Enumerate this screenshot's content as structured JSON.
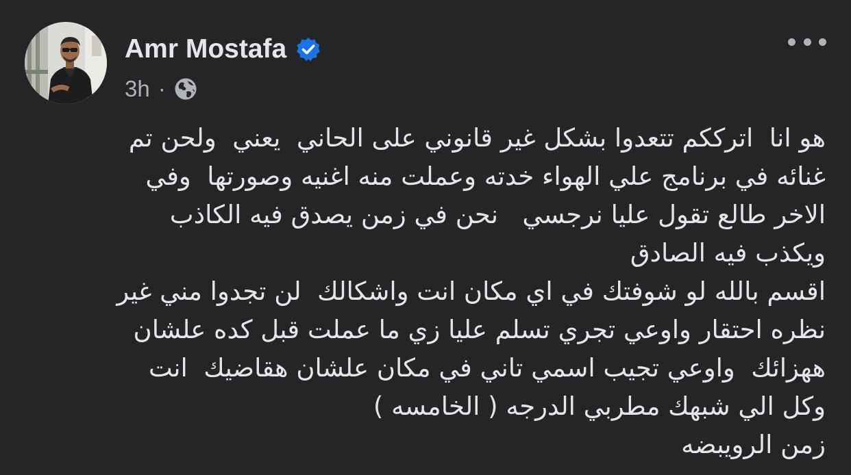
{
  "author": {
    "name": "Amr Mostafa",
    "verified": true,
    "time": "3h",
    "separator": "·",
    "audience_icon": "globe-icon"
  },
  "menu_icon": "more-options-icon",
  "colors": {
    "background": "#242526",
    "text_primary": "#e4e6eb",
    "text_secondary": "#b0b3b8",
    "verified_badge": "#1b74e4"
  },
  "post": {
    "lines": [
      "هو انا  اترككم تتعدوا بشكل غير قانوني على الحاني  يعني  ولحن تم",
      "غنائه في برنامج علي الهواء خدته وعملت منه اغنيه وصورتها  وفي",
      "الاخر طالع تقول عليا نرجسي   نحن في زمن يصدق فيه الكاذب",
      "ويكذب فيه الصادق",
      "اقسم بالله لو شوفتك في اي مكان انت واشكالك  لن تجدوا مني غير",
      "نظره احتقار واوعي تجري تسلم عليا زي ما عملت قبل كده علشان",
      "ههزائك  واوعي تجيب اسمي تاني في مكان علشان هقاضيك  انت",
      "وكل الي شبهك مطربي الدرجه ( الخامسه )",
      "زمن الرويبضه"
    ]
  }
}
